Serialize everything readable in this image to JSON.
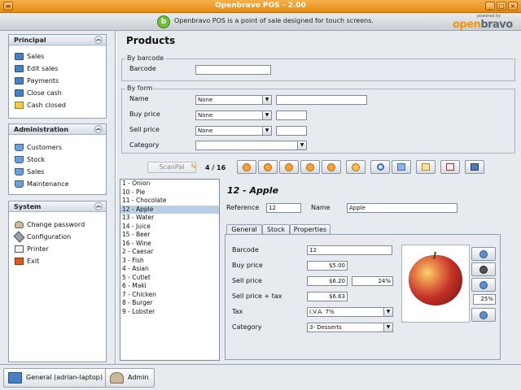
{
  "window": {
    "title": "Openbravo POS - 2.00"
  },
  "banner": {
    "message": "Openbravo POS is a point of sale designed for touch screens.",
    "powered_by": "powered by",
    "brand_open": "open",
    "brand_bravo": "bravo"
  },
  "sidebar": {
    "principal": {
      "title": "Principal",
      "items": [
        {
          "label": "Sales"
        },
        {
          "label": "Edit sales"
        },
        {
          "label": "Payments"
        },
        {
          "label": "Close cash"
        },
        {
          "label": "Cash closed"
        }
      ]
    },
    "administration": {
      "title": "Administration",
      "items": [
        {
          "label": "Customers"
        },
        {
          "label": "Stock"
        },
        {
          "label": "Sales"
        },
        {
          "label": "Maintenance"
        }
      ]
    },
    "system": {
      "title": "System",
      "items": [
        {
          "label": "Change password"
        },
        {
          "label": "Configuration"
        },
        {
          "label": "Printer"
        },
        {
          "label": "Exit"
        }
      ]
    }
  },
  "status": {
    "host": "General (adrian-laptop)",
    "user": "Admin"
  },
  "main": {
    "title": "Products",
    "by_barcode": {
      "legend": "By barcode",
      "label": "Barcode",
      "value": ""
    },
    "by_form": {
      "legend": "By form",
      "name_label": "Name",
      "name_op": "None",
      "name_value": "",
      "buy_label": "Buy price",
      "buy_op": "None",
      "buy_value": "",
      "sell_label": "Sell price",
      "sell_op": "None",
      "sell_value": "",
      "category_label": "Category",
      "category_value": ""
    },
    "toolbar": {
      "scanpal": "ScanPal",
      "counter": "4 / 16"
    },
    "products": [
      "1 - Onion",
      "10 - Pie",
      "11 - Chocolate",
      "12 - Apple",
      "13 - Water",
      "14 - Juice",
      "15 - Beer",
      "16 - Wine",
      "2 - Caesar",
      "3 - Fish",
      "4 - Asian",
      "5 - Cutlet",
      "6 - Maki",
      "7 - Chicken",
      "8 - Burger",
      "9 - Lobster"
    ],
    "selected_index": 3,
    "detail": {
      "title": "12 - Apple",
      "reference_label": "Reference",
      "reference": "12",
      "name_label": "Name",
      "name": "Apple",
      "tabs": [
        "General",
        "Stock",
        "Properties"
      ],
      "barcode_label": "Barcode",
      "barcode": "12",
      "buy_price_label": "Buy price",
      "buy_price": "$5.00",
      "sell_price_label": "Sell price",
      "sell_price": "$6.20",
      "margin": "24%",
      "sell_tax_label": "Sell price + tax",
      "sell_tax": "$6.63",
      "tax_label": "Tax",
      "tax": "I.V.A. 7%",
      "category_label": "Category",
      "category": "3- Desserts",
      "zoom": "25%"
    }
  }
}
